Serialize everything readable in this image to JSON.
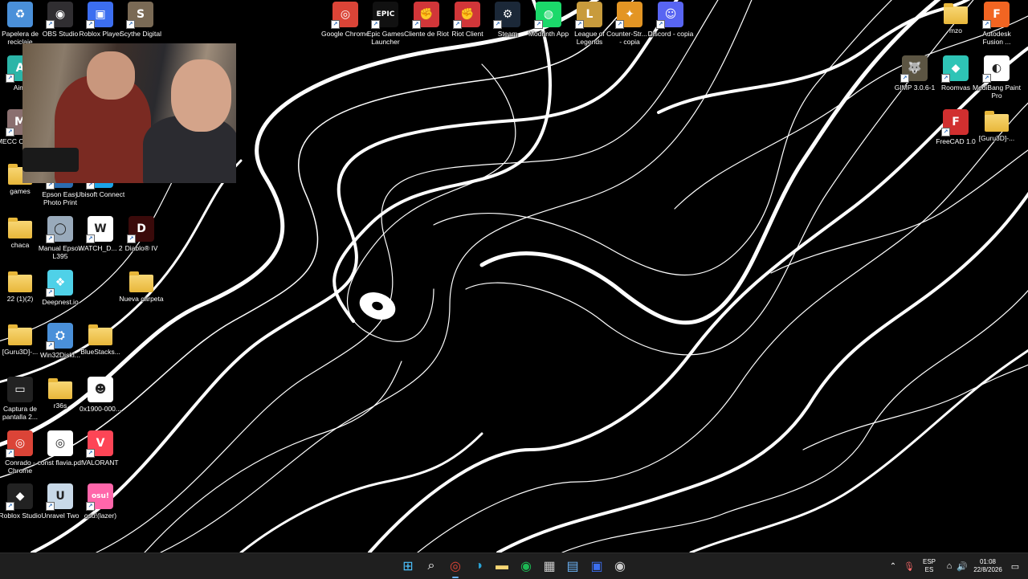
{
  "desktop": {
    "icons": [
      {
        "label": "Papelera de reciclaje",
        "icon": "recycle-bin-icon",
        "color": "#4a90d9",
        "glyph": "♻",
        "shortcut": false
      },
      {
        "label": "OBS Studio",
        "icon": "obs-icon",
        "color": "#302e31",
        "glyph": "◉",
        "shortcut": true
      },
      {
        "label": "Roblox Player",
        "icon": "roblox-icon",
        "color": "#3c6ef0",
        "glyph": "▣",
        "shortcut": true
      },
      {
        "label": "Scythe Digital",
        "icon": "scythe-icon",
        "color": "#7a6a55",
        "glyph": "S",
        "shortcut": true
      },
      {
        "label": "Google Chrome",
        "icon": "chrome-icon",
        "color": "#db4437",
        "glyph": "◎",
        "shortcut": true
      },
      {
        "label": "Epic Games Launcher",
        "icon": "epic-games-icon",
        "color": "#111111",
        "glyph": "EPIC",
        "shortcut": true
      },
      {
        "label": "Cliente de Riot",
        "icon": "riot-icon",
        "color": "#d13639",
        "glyph": "✊",
        "shortcut": true
      },
      {
        "label": "Riot Client",
        "icon": "riot-client-icon",
        "color": "#d13639",
        "glyph": "✊",
        "shortcut": true
      },
      {
        "label": "Steam",
        "icon": "steam-icon",
        "color": "#1b2838",
        "glyph": "⚙",
        "shortcut": true
      },
      {
        "label": "Modrinth App",
        "icon": "modrinth-icon",
        "color": "#1bd96a",
        "glyph": "◍",
        "shortcut": true
      },
      {
        "label": "League of Legends",
        "icon": "league-icon",
        "color": "#c89b3c",
        "glyph": "L",
        "shortcut": true
      },
      {
        "label": "Counter-Str... 2 - copia",
        "icon": "counter-strike-icon",
        "color": "#e39524",
        "glyph": "✦",
        "shortcut": true
      },
      {
        "label": "Discord - copia",
        "icon": "discord-icon",
        "color": "#5865f2",
        "glyph": "☺",
        "shortcut": true
      },
      {
        "label": "mzo",
        "icon": "folder-icon",
        "color": "#f8d775",
        "glyph": "",
        "shortcut": false
      },
      {
        "label": "Autodesk Fusion ...",
        "icon": "fusion-icon",
        "color": "#f26522",
        "glyph": "F",
        "shortcut": true
      },
      {
        "label": "Aiml",
        "icon": "aiml-icon",
        "color": "#2bb5a8",
        "glyph": "A",
        "shortcut": true
      },
      {
        "label": "GIMP 3.0.6-1",
        "icon": "gimp-icon",
        "color": "#5c5543",
        "glyph": "🐺",
        "shortcut": true
      },
      {
        "label": "Roomvas",
        "icon": "roomvas-icon",
        "color": "#2ec4b6",
        "glyph": "◆",
        "shortcut": true
      },
      {
        "label": "MediBang Paint Pro",
        "icon": "medibang-icon",
        "color": "#ffffff",
        "glyph": "◐",
        "shortcut": true
      },
      {
        "label": "MECC CHAMB",
        "icon": "mecc-icon",
        "color": "#8a6f6f",
        "glyph": "M",
        "shortcut": true
      },
      {
        "label": "FreeCAD 1.0",
        "icon": "freecad-icon",
        "color": "#d12f2f",
        "glyph": "F",
        "shortcut": true
      },
      {
        "label": "[Guru3D]-...",
        "icon": "folder-icon",
        "color": "#f8d775",
        "glyph": "",
        "shortcut": false
      },
      {
        "label": "games",
        "icon": "folder-icon",
        "color": "#f8d775",
        "glyph": "",
        "shortcut": false
      },
      {
        "label": "Epson Easy Photo Print",
        "icon": "epson-photo-icon",
        "color": "#2b6cb0",
        "glyph": "E",
        "shortcut": true
      },
      {
        "label": "Ubisoft Connect",
        "icon": "ubisoft-icon",
        "color": "#1aa3e8",
        "glyph": "U",
        "shortcut": true
      },
      {
        "label": "chaca",
        "icon": "folder-icon",
        "color": "#f8d775",
        "glyph": "",
        "shortcut": false
      },
      {
        "label": "Manual Epson L395",
        "icon": "epson-manual-icon",
        "color": "#9ab",
        "glyph": "◯",
        "shortcut": true
      },
      {
        "label": "WATCH_D... 2",
        "icon": "watch-dogs-icon",
        "color": "#ffffff",
        "glyph": "W",
        "shortcut": true
      },
      {
        "label": "Diablo® IV",
        "icon": "diablo-icon",
        "color": "#3a0a0a",
        "glyph": "D",
        "shortcut": true
      },
      {
        "label": "22 (1)(2)",
        "icon": "folder-icon",
        "color": "#f8d775",
        "glyph": "",
        "shortcut": false
      },
      {
        "label": "Deepnest.io",
        "icon": "deepnest-icon",
        "color": "#4fd1e8",
        "glyph": "❖",
        "shortcut": true
      },
      {
        "label": "Nueva carpeta",
        "icon": "folder-icon",
        "color": "#f8d775",
        "glyph": "",
        "shortcut": false
      },
      {
        "label": "[Guru3D]-...",
        "icon": "folder-icon",
        "color": "#f8d775",
        "glyph": "",
        "shortcut": false
      },
      {
        "label": "Win32DiskI...",
        "icon": "win32disk-icon",
        "color": "#4a90d9",
        "glyph": "⛭",
        "shortcut": true
      },
      {
        "label": "BlueStacks...",
        "icon": "folder-icon",
        "color": "#f8d775",
        "glyph": "",
        "shortcut": false
      },
      {
        "label": "Captura de pantalla 2...",
        "icon": "screenshot-icon",
        "color": "#222222",
        "glyph": "▭",
        "shortcut": false
      },
      {
        "label": "r36s",
        "icon": "folder-icon",
        "color": "#f8d775",
        "glyph": "",
        "shortcut": false
      },
      {
        "label": "0x1900-000...",
        "icon": "troll-face-icon",
        "color": "#ffffff",
        "glyph": "☻",
        "shortcut": false
      },
      {
        "label": "Conrado - Chrome",
        "icon": "chrome-profile-icon",
        "color": "#db4437",
        "glyph": "◎",
        "shortcut": true
      },
      {
        "label": "const flavia.pdf",
        "icon": "pdf-chrome-icon",
        "color": "#ffffff",
        "glyph": "◎",
        "shortcut": false
      },
      {
        "label": "VALORANT",
        "icon": "valorant-icon",
        "color": "#fd4556",
        "glyph": "V",
        "shortcut": true
      },
      {
        "label": "Roblox Studio",
        "icon": "roblox-studio-icon",
        "color": "#222222",
        "glyph": "◆",
        "shortcut": true
      },
      {
        "label": "Unravel Two",
        "icon": "unravel-icon",
        "color": "#c8d9e8",
        "glyph": "U",
        "shortcut": true
      },
      {
        "label": "osu!(lazer)",
        "icon": "osu-icon",
        "color": "#ff66aa",
        "glyph": "osu!",
        "shortcut": true
      }
    ]
  },
  "taskbar": {
    "apps": [
      {
        "name": "start-button",
        "icon": "windows-start-icon",
        "glyph": "⊞",
        "color": "#4cc2ff",
        "active": false
      },
      {
        "name": "search-button",
        "icon": "search-icon",
        "glyph": "⌕",
        "color": "#ffffff",
        "active": false
      },
      {
        "name": "taskbar-chrome",
        "icon": "chrome-icon",
        "glyph": "◎",
        "color": "#db4437",
        "active": true
      },
      {
        "name": "taskbar-edge",
        "icon": "edge-icon",
        "glyph": "◑",
        "color": "#2aa4d6",
        "active": false
      },
      {
        "name": "taskbar-file-explorer",
        "icon": "folder-icon",
        "glyph": "▬",
        "color": "#f8d775",
        "active": false
      },
      {
        "name": "taskbar-spotify",
        "icon": "spotify-icon",
        "glyph": "◉",
        "color": "#1db954",
        "active": false
      },
      {
        "name": "taskbar-store",
        "icon": "store-icon",
        "glyph": "▦",
        "color": "#cccccc",
        "active": false
      },
      {
        "name": "taskbar-task-manager",
        "icon": "window-icon",
        "glyph": "▤",
        "color": "#6ab0f3",
        "active": false
      },
      {
        "name": "taskbar-roblox",
        "icon": "roblox-icon",
        "glyph": "▣",
        "color": "#3c6ef0",
        "active": false
      },
      {
        "name": "taskbar-obs",
        "icon": "obs-icon",
        "glyph": "◉",
        "color": "#cccccc",
        "active": false
      }
    ],
    "tray": {
      "language": "ESP",
      "region": "ES",
      "time": "01:08",
      "date": "22/8/2026"
    }
  }
}
